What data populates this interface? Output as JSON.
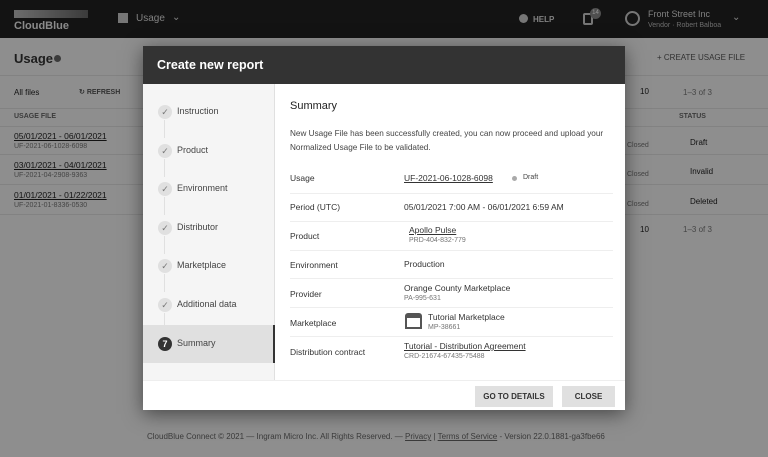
{
  "header": {
    "brand": "CloudBlue",
    "module": "Usage",
    "help": "HELP",
    "notifications_count": "14",
    "account_name": "Front Street Inc",
    "account_sub": "Vendor · Robert Balboa"
  },
  "page": {
    "title": "Usage",
    "create_button": "CREATE USAGE FILE",
    "filter": "All files",
    "refresh": "REFRESH",
    "page_size": "10",
    "pagination": "1–3 of 3",
    "columns": {
      "usage_file": "USAGE FILE",
      "status": "STATUS"
    },
    "rows": [
      {
        "period": "05/01/2021 - 06/01/2021",
        "id": "UF-2021-06-1028-6098",
        "closed": "Closed",
        "status": "Draft"
      },
      {
        "period": "03/01/2021 - 04/01/2021",
        "id": "UF-2021-04-2908-9363",
        "closed": "Closed",
        "status": "Invalid"
      },
      {
        "period": "01/01/2021 - 01/22/2021",
        "id": "UF-2021-01-8336-0530",
        "closed": "Closed",
        "status": "Deleted"
      }
    ]
  },
  "footer": {
    "copyright": "CloudBlue Connect © 2021 — Ingram Micro Inc. All Rights Reserved. —",
    "privacy": "Privacy",
    "sep": "|",
    "terms": "Terms of Service",
    "version": "- Version 22.0.1881-ga3fbe66"
  },
  "modal": {
    "title": "Create new report",
    "steps": [
      {
        "label": "Instruction"
      },
      {
        "label": "Product"
      },
      {
        "label": "Environment"
      },
      {
        "label": "Distributor"
      },
      {
        "label": "Marketplace"
      },
      {
        "label": "Additional data"
      },
      {
        "label": "Summary",
        "number": "7"
      }
    ],
    "summary": {
      "heading": "Summary",
      "message": "New Usage File has been successfully created, you can now proceed and upload your Normalized Usage File to be validated.",
      "usage_label": "Usage",
      "usage_id": "UF-2021-06-1028-6098",
      "usage_status": "Draft",
      "period_label": "Period (UTC)",
      "period": "05/01/2021 7:00 AM - 06/01/2021 6:59 AM",
      "product_label": "Product",
      "product_name": "Apollo Pulse",
      "product_id": "PRD-404-832-779",
      "environment_label": "Environment",
      "environment": "Production",
      "provider_label": "Provider",
      "provider_name": "Orange County Marketplace",
      "provider_id": "PA-995-631",
      "marketplace_label": "Marketplace",
      "marketplace_name": "Tutorial Marketplace",
      "marketplace_id": "MP-38661",
      "contract_label": "Distribution contract",
      "contract_name": "Tutorial - Distribution Agreement",
      "contract_id": "CRD-21674-67435-75488"
    },
    "go_to_details": "GO TO DETAILS",
    "close": "CLOSE"
  }
}
